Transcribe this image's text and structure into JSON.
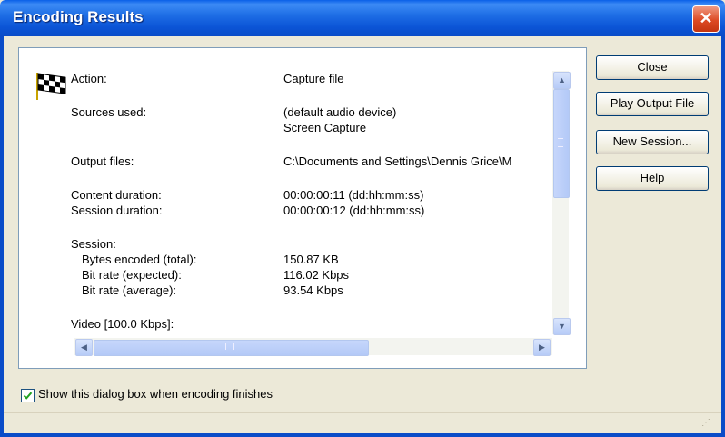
{
  "window": {
    "title": "Encoding Results",
    "close_glyph": "✕"
  },
  "results": {
    "action_label": "Action:",
    "action_value": "Capture file",
    "sources_label": "Sources used:",
    "sources_value_1": "(default audio device)",
    "sources_value_2": "Screen Capture",
    "output_label": "Output files:",
    "output_value": "C:\\Documents and Settings\\Dennis Grice\\M",
    "content_duration_label": "Content duration:",
    "content_duration_value": "00:00:00:11  (dd:hh:mm:ss)",
    "session_duration_label": "Session duration:",
    "session_duration_value": "00:00:00:12  (dd:hh:mm:ss)",
    "session_label": "Session:",
    "bytes_label": "Bytes encoded (total):",
    "bytes_value": "150.87 KB",
    "bitrate_expected_label": "Bit rate (expected):",
    "bitrate_expected_value": "116.02 Kbps",
    "bitrate_average_label": "Bit rate (average):",
    "bitrate_average_value": "93.54 Kbps",
    "video_label": "Video [100.0 Kbps]:"
  },
  "buttons": {
    "close": "Close",
    "play_output": "Play Output File",
    "new_session": "New Session...",
    "help": "Help"
  },
  "checkbox": {
    "label": "Show this dialog box when encoding finishes",
    "checked": true
  },
  "icons": {
    "flag": "checkered-flag-icon",
    "scroll_up": "▲",
    "scroll_down": "▼",
    "scroll_left": "◀",
    "scroll_right": "▶"
  },
  "colors": {
    "titlebar": "#0a54d6",
    "close_button": "#dd4a24",
    "dialog_bg": "#ece9d8"
  }
}
